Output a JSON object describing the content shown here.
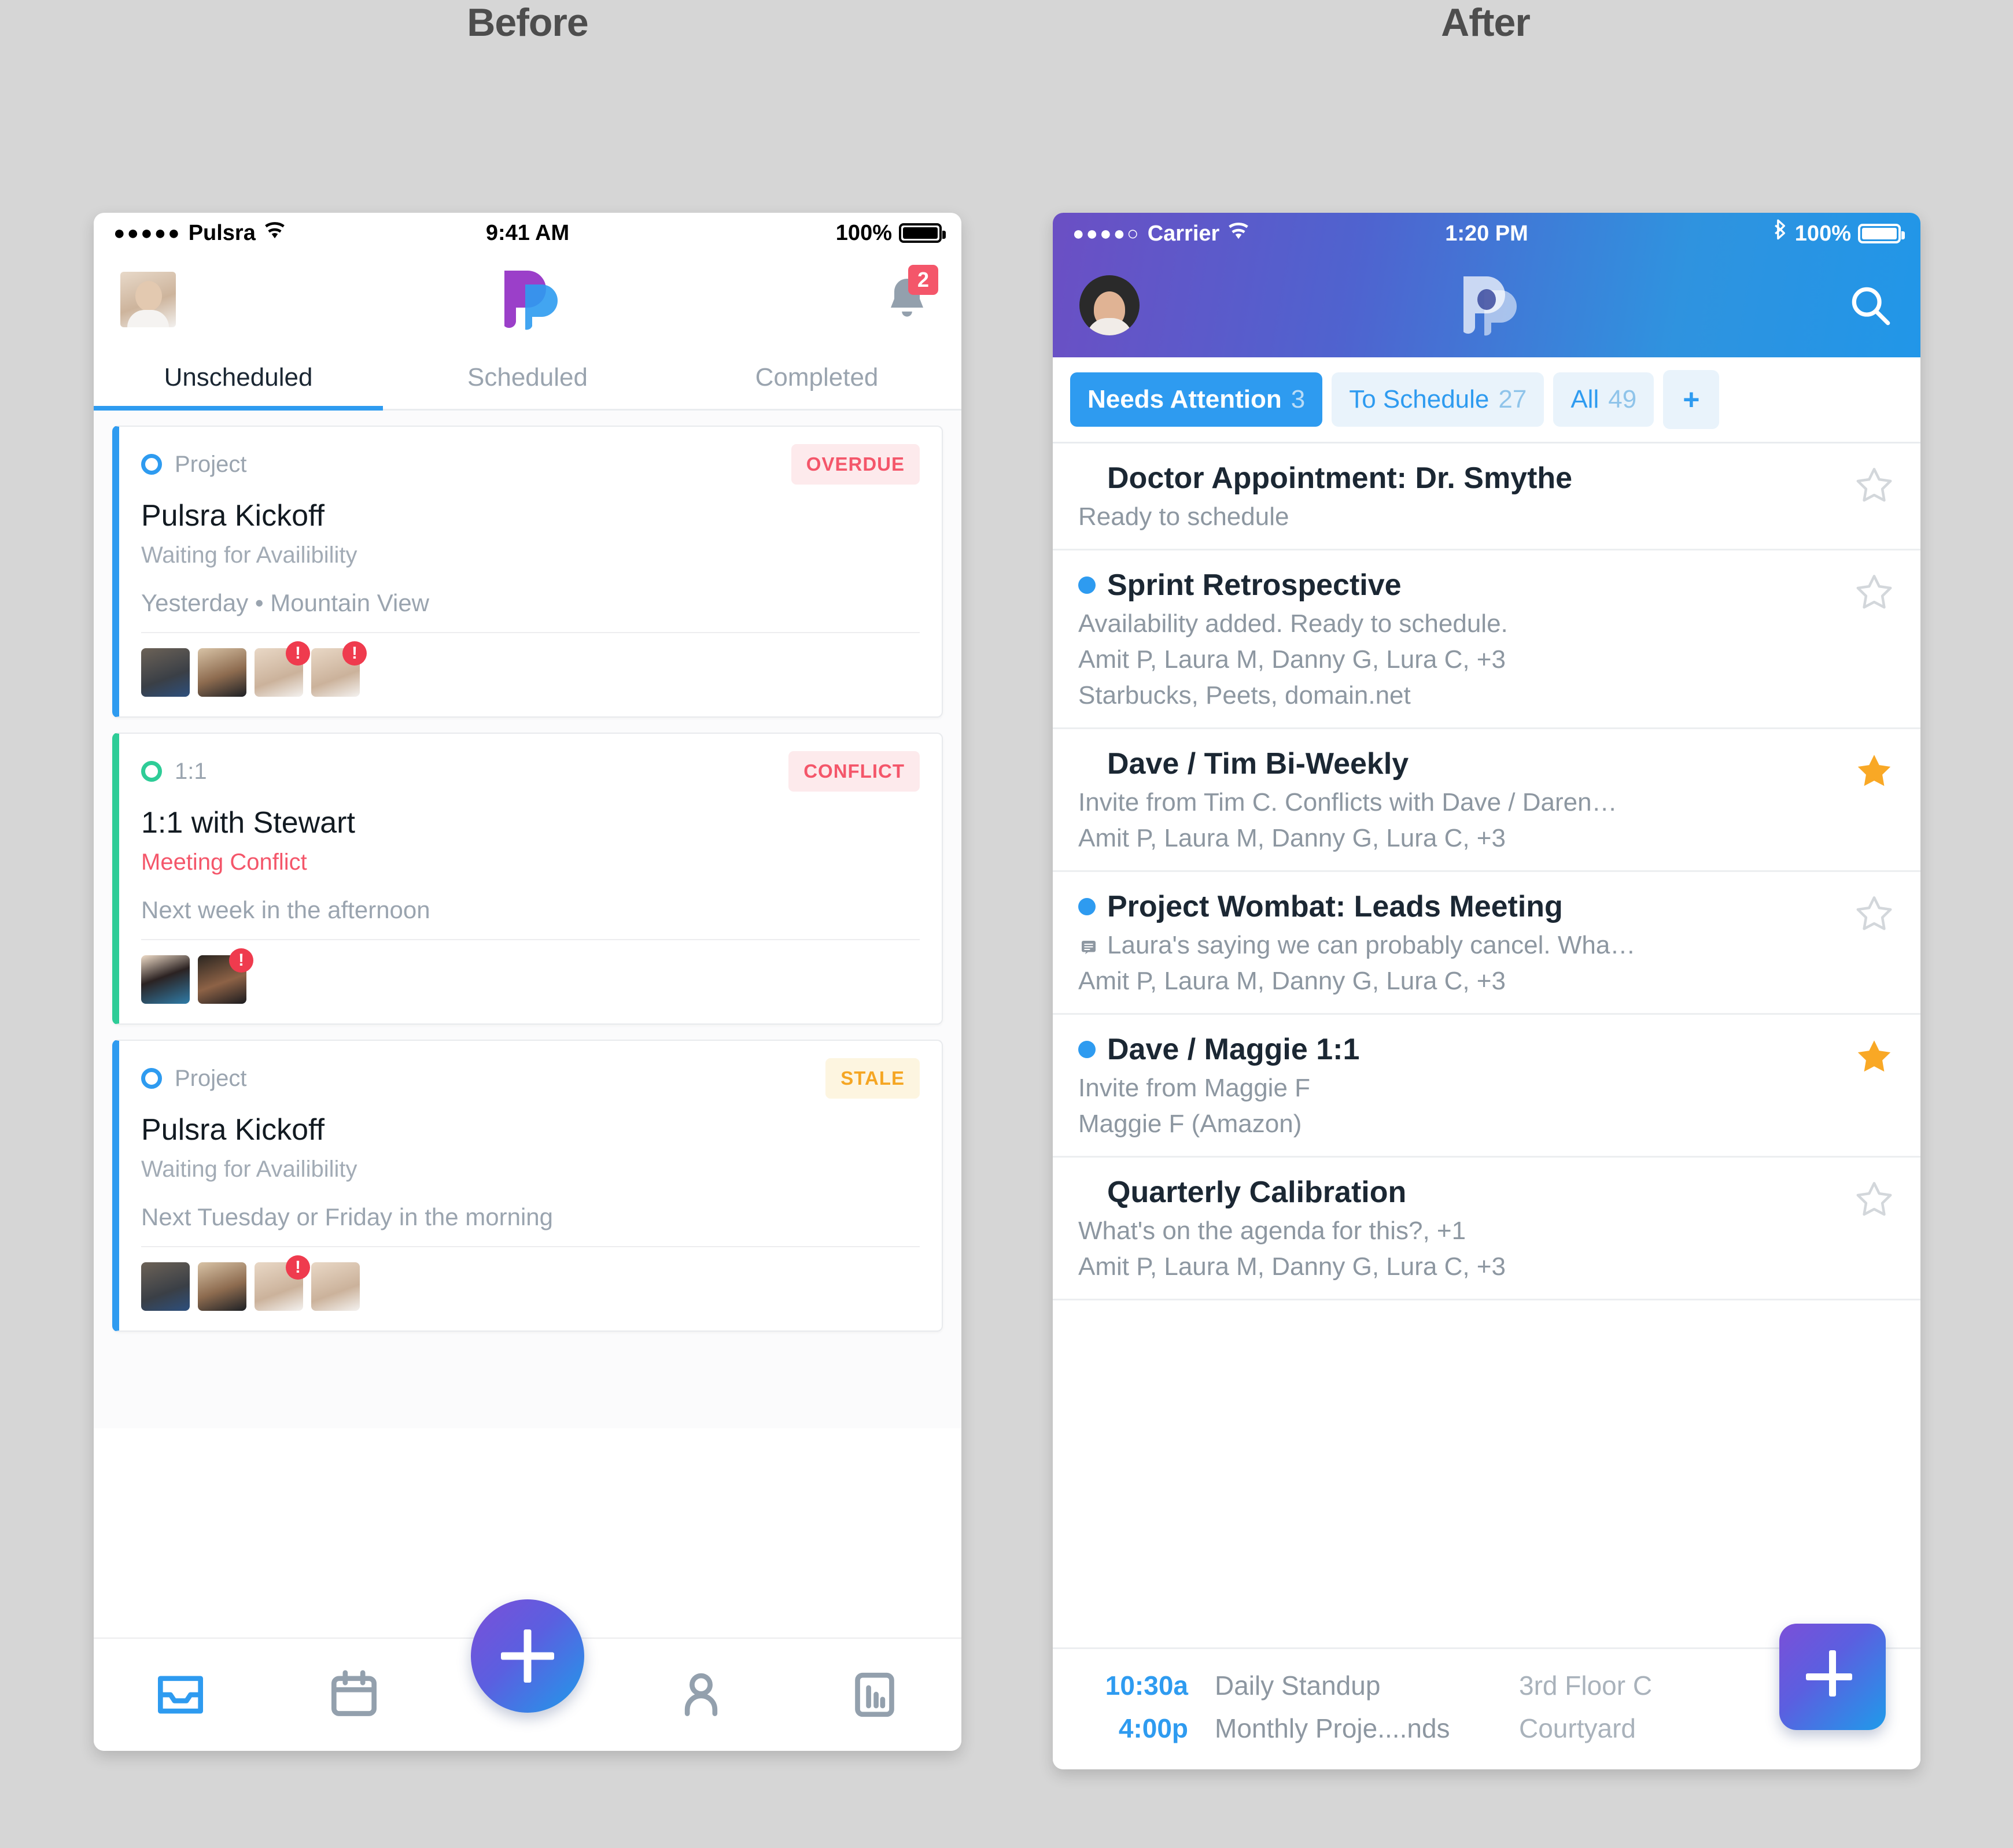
{
  "headings": {
    "before": "Before",
    "after": "After"
  },
  "before": {
    "status_bar": {
      "signal_dots": "●●●●●",
      "carrier": "Pulsra",
      "wifi_icon": "wifi-icon",
      "time": "9:41 AM",
      "battery_percent": "100%",
      "battery_icon": "battery-full-icon"
    },
    "nav": {
      "avatar": "user-avatar",
      "logo": "pulsra-logo",
      "bell_icon": "bell-icon",
      "badge_count": "2"
    },
    "tabs": [
      {
        "label": "Unscheduled",
        "active": true
      },
      {
        "label": "Scheduled",
        "active": false
      },
      {
        "label": "Completed",
        "active": false
      }
    ],
    "cards": [
      {
        "type": "Project",
        "accent": "#2e9bf0",
        "pill": {
          "label": "OVERDUE",
          "style": "red"
        },
        "title": "Pulsra Kickoff",
        "subtitle": "Waiting for Availibility",
        "subtitle_danger": false,
        "when": "Yesterday • Mountain View",
        "faces": [
          {
            "alert": false
          },
          {
            "alert": false
          },
          {
            "alert": true
          },
          {
            "alert": true
          }
        ]
      },
      {
        "type": "1:1",
        "accent": "#2ecc97",
        "pill": {
          "label": "CONFLICT",
          "style": "red"
        },
        "title": "1:1 with Stewart",
        "subtitle": "Meeting Conflict",
        "subtitle_danger": true,
        "when": "Next week in the afternoon",
        "faces": [
          {
            "alert": false
          },
          {
            "alert": true
          }
        ]
      },
      {
        "type": "Project",
        "accent": "#2e9bf0",
        "pill": {
          "label": "STALE",
          "style": "yellow"
        },
        "title": "Pulsra Kickoff",
        "subtitle": "Waiting for Availibility",
        "subtitle_danger": false,
        "when": "Next Tuesday or Friday in the morning",
        "faces": [
          {
            "alert": false
          },
          {
            "alert": false
          },
          {
            "alert": true
          },
          {
            "alert": false
          }
        ]
      }
    ],
    "tabbar": [
      {
        "icon": "inbox-icon",
        "active": true
      },
      {
        "icon": "calendar-icon",
        "active": false
      },
      {
        "icon": "spacer",
        "active": false
      },
      {
        "icon": "person-icon",
        "active": false
      },
      {
        "icon": "chart-bar-icon",
        "active": false
      }
    ],
    "fab": {
      "icon": "plus-icon"
    }
  },
  "after": {
    "status_bar": {
      "signal_dots": "●●●●○",
      "carrier": "Carrier",
      "wifi_icon": "wifi-icon",
      "time": "1:20 PM",
      "bluetooth_icon": "bluetooth-icon",
      "battery_percent": "100%",
      "battery_icon": "battery-full-icon"
    },
    "nav": {
      "avatar": "user-avatar",
      "logo": "pulsra-logo",
      "search_icon": "search-icon"
    },
    "chips": [
      {
        "label": "Needs Attention",
        "count": "3",
        "active": true
      },
      {
        "label": "To Schedule",
        "count": "27",
        "active": false
      },
      {
        "label": "All",
        "count": "49",
        "active": false
      },
      {
        "label": "+",
        "count": "",
        "active": false,
        "is_plus": true
      }
    ],
    "rows": [
      {
        "unread": false,
        "title": "Doctor Appointment: Dr. Smythe",
        "lines": [
          {
            "text": "Ready to schedule",
            "icon": null
          }
        ],
        "starred": false
      },
      {
        "unread": true,
        "title": "Sprint Retrospective",
        "lines": [
          {
            "text": "Availability added. Ready to schedule.",
            "icon": null
          },
          {
            "text": "Amit P, Laura M, Danny G, Lura C, +3",
            "icon": null
          },
          {
            "text": "Starbucks, Peets, domain.net",
            "icon": null
          }
        ],
        "starred": false
      },
      {
        "unread": false,
        "title": "Dave / Tim Bi-Weekly",
        "lines": [
          {
            "text": "Invite from Tim C. Conflicts with Dave / Daren…",
            "icon": null
          },
          {
            "text": "Amit P, Laura M, Danny G, Lura C, +3",
            "icon": null
          }
        ],
        "starred": true
      },
      {
        "unread": true,
        "title": "Project Wombat: Leads Meeting",
        "lines": [
          {
            "text": "Laura's saying we can probably cancel. Wha…",
            "icon": "message-icon"
          },
          {
            "text": "Amit P, Laura M, Danny G, Lura C, +3",
            "icon": null
          }
        ],
        "starred": false
      },
      {
        "unread": true,
        "title": "Dave / Maggie 1:1",
        "lines": [
          {
            "text": "Invite from Maggie F",
            "icon": null
          },
          {
            "text": "Maggie F (Amazon)",
            "icon": null
          }
        ],
        "starred": true
      },
      {
        "unread": false,
        "title": "Quarterly Calibration",
        "lines": [
          {
            "text": "What's on the agenda for this?, +1",
            "icon": null
          },
          {
            "text": "Amit P, Laura M, Danny G, Lura C, +3",
            "icon": null
          }
        ],
        "starred": false
      }
    ],
    "schedule": [
      {
        "time": "10:30a",
        "name": "Daily Standup",
        "location": "3rd Floor C"
      },
      {
        "time": "4:00p",
        "name": "Monthly Proje....nds",
        "location": "Courtyard"
      }
    ],
    "fab": {
      "icon": "plus-icon"
    }
  },
  "colors": {
    "accent_blue": "#2e9bf0",
    "accent_green": "#2ecc97",
    "danger_red": "#f4566a",
    "warning_yellow": "#f5a623",
    "star_gold": "#f9a825",
    "page_bg": "#d6d6d6"
  }
}
